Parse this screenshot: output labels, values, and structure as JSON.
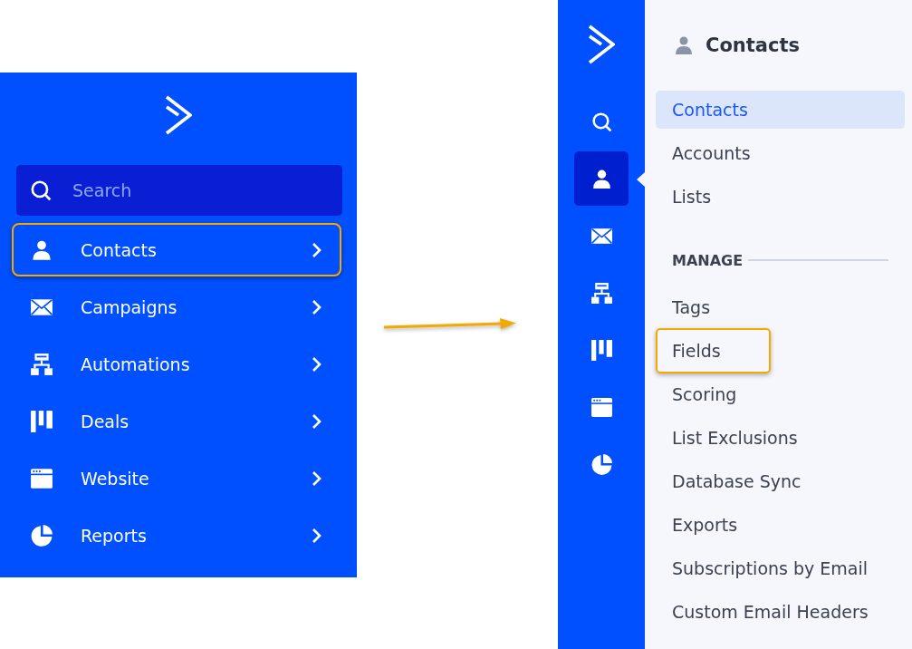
{
  "expanded_menu": {
    "search": {
      "placeholder": "Search"
    },
    "items": [
      {
        "label": "Contacts",
        "highlighted": true
      },
      {
        "label": "Campaigns",
        "highlighted": false
      },
      {
        "label": "Automations",
        "highlighted": false
      },
      {
        "label": "Deals",
        "highlighted": false
      },
      {
        "label": "Website",
        "highlighted": false
      },
      {
        "label": "Reports",
        "highlighted": false
      }
    ]
  },
  "icon_rail": {
    "items": [
      {
        "selected": false
      },
      {
        "selected": true
      },
      {
        "selected": false
      },
      {
        "selected": false
      },
      {
        "selected": false
      },
      {
        "selected": false
      },
      {
        "selected": false
      }
    ]
  },
  "submenu": {
    "title": "Contacts",
    "items": [
      {
        "label": "Contacts",
        "selected": true,
        "highlighted": false
      },
      {
        "label": "Accounts",
        "selected": false,
        "highlighted": false
      },
      {
        "label": "Lists",
        "selected": false,
        "highlighted": false
      }
    ],
    "section": {
      "title": "MANAGE",
      "items": [
        {
          "label": "Tags",
          "selected": false,
          "highlighted": false
        },
        {
          "label": "Fields",
          "selected": false,
          "highlighted": true
        },
        {
          "label": "Scoring",
          "selected": false,
          "highlighted": false
        },
        {
          "label": "List Exclusions",
          "selected": false,
          "highlighted": false
        },
        {
          "label": "Database Sync",
          "selected": false,
          "highlighted": false
        },
        {
          "label": "Exports",
          "selected": false,
          "highlighted": false
        },
        {
          "label": "Subscriptions by Email",
          "selected": false,
          "highlighted": false
        },
        {
          "label": "Custom Email Headers",
          "selected": false,
          "highlighted": false
        }
      ]
    }
  }
}
